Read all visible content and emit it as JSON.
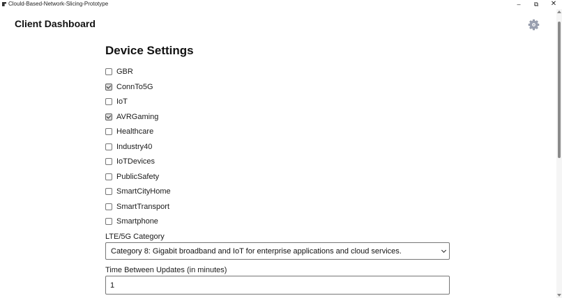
{
  "window": {
    "title": "Clould-Based-Network-Slicing-Prototype",
    "minimize": "–",
    "maximize": "⧉",
    "close": "✕"
  },
  "header": {
    "title": "Client Dashboard",
    "settings_icon": "gear-icon"
  },
  "device_settings": {
    "title": "Device Settings",
    "options": [
      {
        "label": "GBR",
        "checked": false
      },
      {
        "label": "ConnTo5G",
        "checked": true
      },
      {
        "label": "IoT",
        "checked": false
      },
      {
        "label": "AVRGaming",
        "checked": true
      },
      {
        "label": "Healthcare",
        "checked": false
      },
      {
        "label": "Industry40",
        "checked": false
      },
      {
        "label": "IoTDevices",
        "checked": false
      },
      {
        "label": "PublicSafety",
        "checked": false
      },
      {
        "label": "SmartCityHome",
        "checked": false
      },
      {
        "label": "SmartTransport",
        "checked": false
      },
      {
        "label": "Smartphone",
        "checked": false
      }
    ],
    "category": {
      "label": "LTE/5G Category",
      "selected": "Category 8: Gigabit broadband and IoT for enterprise applications and cloud services."
    },
    "update_interval": {
      "label": "Time Between Updates (in minutes)",
      "value": "1"
    }
  },
  "colors": {
    "background": "#ffffff",
    "text": "#111111",
    "border": "#767676",
    "gear": "#9aa0b0"
  }
}
